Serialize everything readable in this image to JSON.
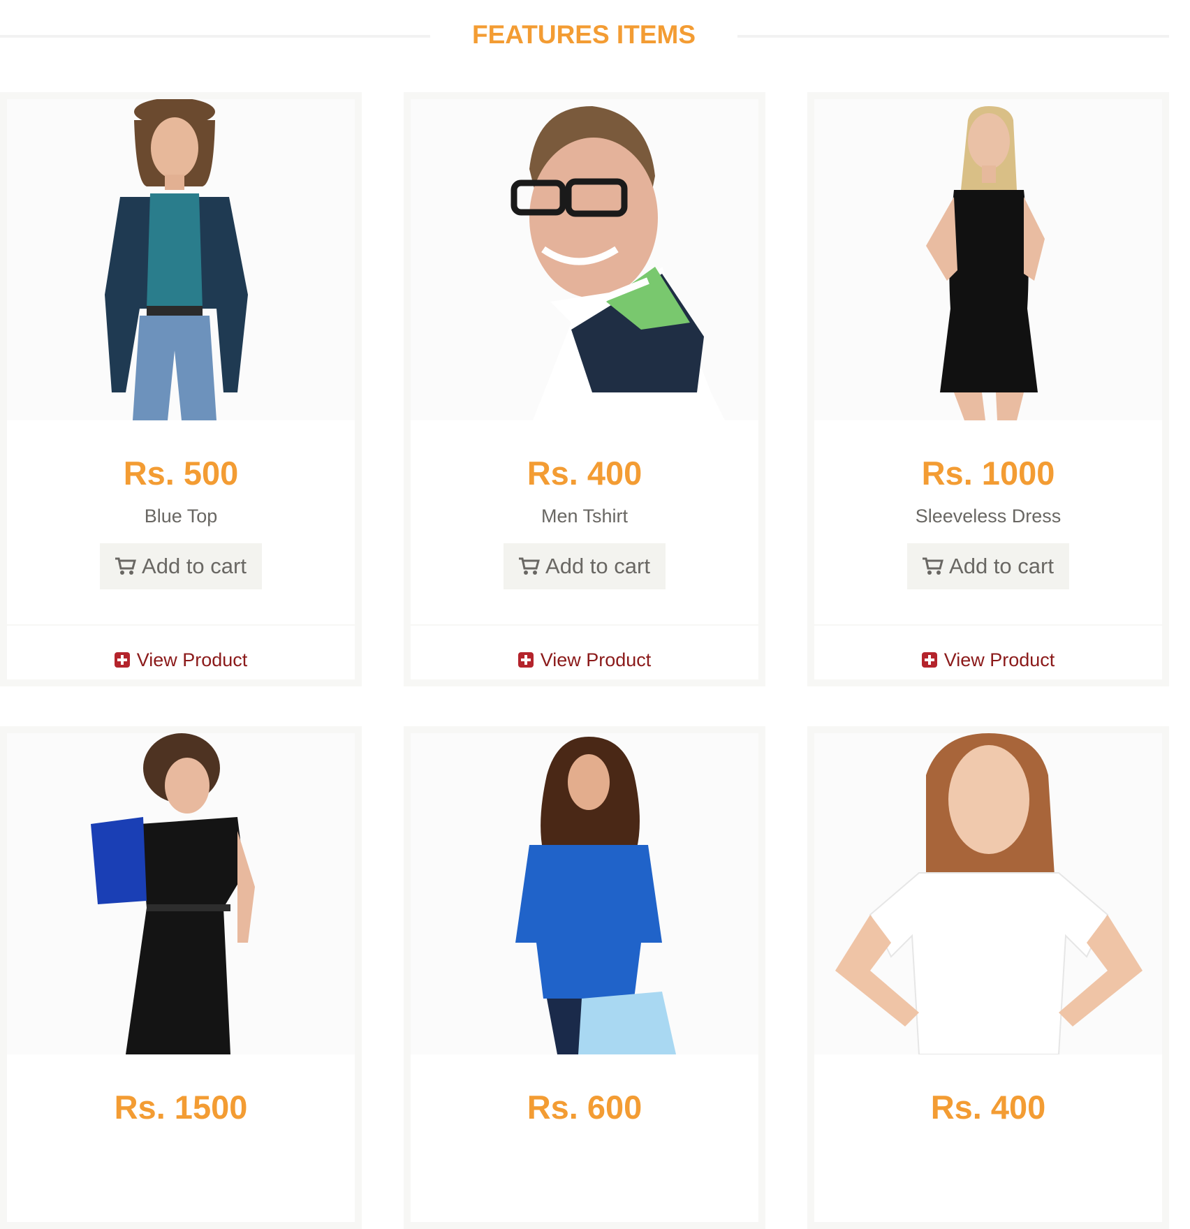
{
  "section": {
    "title": "FEATURES ITEMS"
  },
  "colors": {
    "accent": "#f39c33",
    "link": "#8b1a1a",
    "button_bg": "#f3f3ef",
    "text": "#696763"
  },
  "products": [
    {
      "price": "Rs. 500",
      "name": "Blue Top",
      "cart_label": "Add to cart",
      "view_label": "View Product"
    },
    {
      "price": "Rs. 400",
      "name": "Men Tshirt",
      "cart_label": "Add to cart",
      "view_label": "View Product"
    },
    {
      "price": "Rs. 1000",
      "name": "Sleeveless Dress",
      "cart_label": "Add to cart",
      "view_label": "View Product"
    },
    {
      "price": "Rs. 1500"
    },
    {
      "price": "Rs. 600"
    },
    {
      "price": "Rs. 400"
    }
  ]
}
